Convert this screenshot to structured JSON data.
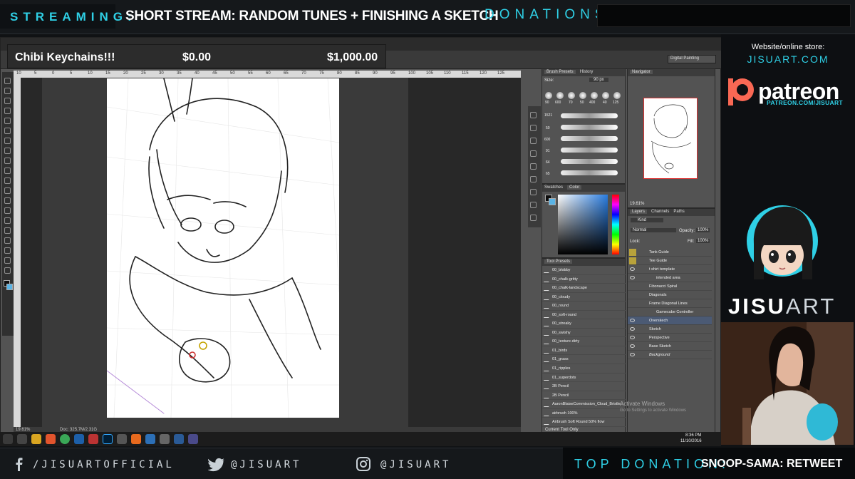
{
  "banner": {
    "streaming_label": "STREAMING:",
    "stream_title": "SHORT STREAM: RANDOM TUNES + FINISHING A SKETCH",
    "donations_label": "DONATIONS"
  },
  "donation_goal": {
    "item": "Chibi Keychains!!!",
    "current": "$0.00",
    "goal": "$1,000.00"
  },
  "photoshop": {
    "workspace": "Digital Painting",
    "ruler_ticks": [
      "10",
      "5",
      "0",
      "5",
      "10",
      "15",
      "20",
      "25",
      "30",
      "35",
      "40",
      "45",
      "50",
      "55",
      "60",
      "65",
      "70",
      "75",
      "80",
      "85",
      "90",
      "95",
      "100",
      "105",
      "110",
      "115",
      "120",
      "125"
    ],
    "status_zoom": "19.61%",
    "status_doc": "Doc: 325.7M/2.31G",
    "brush_panel": {
      "tabs": [
        "Brush Presets",
        "History"
      ],
      "size_label": "Size:",
      "size_value": "90 px",
      "brush_sizes": [
        "90",
        "600",
        "70",
        "50",
        "400",
        "40",
        "125"
      ],
      "stroke_sizes": [
        "1521",
        "50",
        "600",
        "91",
        "64",
        "65"
      ]
    },
    "color_panel": {
      "tabs": [
        "Swatches",
        "Color"
      ],
      "foreground": "#0d0d0d",
      "background": "#5ab4e6"
    },
    "navigator": {
      "tab": "Navigator",
      "zoom": "19.61%"
    },
    "tool_presets": {
      "tab": "Tool Presets",
      "items": [
        "00_blobby",
        "00_chalk-gritty",
        "00_chalk-landscape",
        "00_cloudy",
        "00_round",
        "00_soft-round",
        "00_streaky",
        "00_swishy",
        "00_texture-dirty",
        "01_birds",
        "01_grass",
        "01_ripples",
        "01_superdots",
        "2B Pencil",
        "2B Pencil",
        "AaronBlaiseCommission_Cloud_Bristle...",
        "airbrush 100%",
        "Airbrush Soft Round 50% flow"
      ],
      "footer": "Current Tool Only"
    },
    "layers": {
      "tabs": [
        "Layers",
        "Channels",
        "Paths"
      ],
      "kind_label": "Kind",
      "blend_mode": "Normal",
      "opacity_label": "Opacity:",
      "opacity_value": "100%",
      "lock_label": "Lock:",
      "fill_label": "Fill:",
      "fill_value": "100%",
      "items": [
        "Tank Guide",
        "Tee Guide",
        "t shirt template",
        "intended area",
        "Fibonacci Spiral",
        "Diagonals",
        "Frame Diagonal Lines",
        "Gamecube Controller",
        "Overskech",
        "Sketch",
        "Perspective",
        "Base Sketch",
        "Background"
      ]
    },
    "activate_windows": "Activate Windows",
    "activate_windows_sub": "Go to Settings to activate Windows",
    "clock_time": "8:36 PM",
    "clock_date": "11/10/2016"
  },
  "sidebar": {
    "website_label": "Website/online store:",
    "website_url": "JISUART.COM",
    "patreon_word": "patreon",
    "patreon_url": "PATREON.COM/JISUART",
    "logo_bold": "JISU",
    "logo_light": "ART"
  },
  "footer": {
    "facebook": "/JISUARTOFFICIAL",
    "twitter": "@JISUART",
    "instagram": "@JISUART",
    "top_donation_label": "TOP DONATION:",
    "top_donation_value": "SNOOP-SAMA: RETWEET"
  },
  "colors": {
    "accent": "#2fd0e6",
    "patreon": "#f96854",
    "layer_selected": "#4b5a74",
    "folder": "#b8a23b"
  }
}
